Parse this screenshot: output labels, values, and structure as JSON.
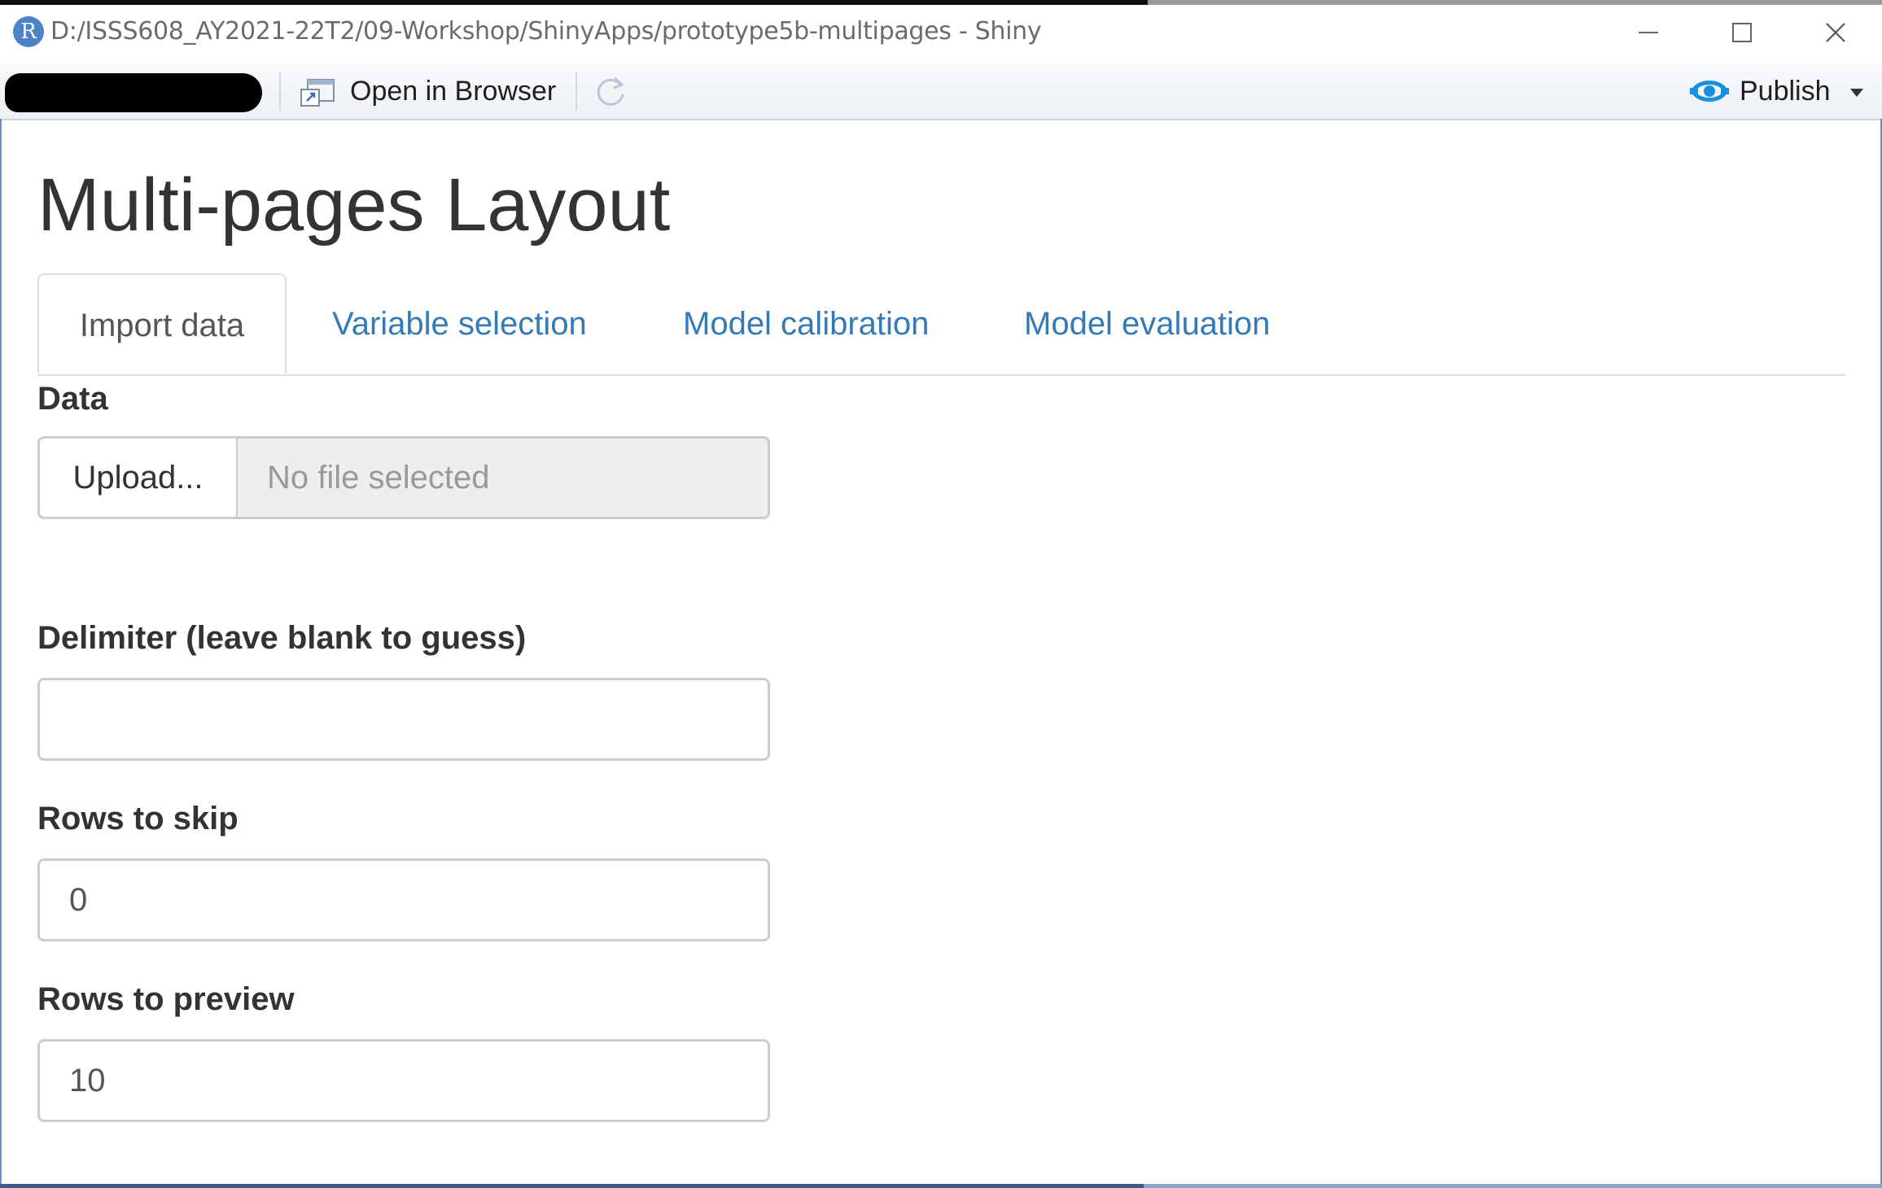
{
  "window": {
    "title": "D:/ISSS608_AY2021-22T2/09-Workshop/ShinyApps/prototype5b-multipages - Shiny",
    "logo_letter": "R",
    "minimize_icon": "minimize-icon",
    "maximize_icon": "maximize-icon",
    "close_icon": "close-icon"
  },
  "toolbar": {
    "open_in_browser_label": "Open in Browser",
    "open_in_browser_icon": "browser-window-icon",
    "reload_icon": "refresh-icon",
    "publish_label": "Publish",
    "publish_icon": "publish-icon",
    "publish_caret_icon": "chevron-down-icon"
  },
  "page": {
    "title": "Multi-pages Layout",
    "tabs": [
      {
        "label": "Import data",
        "active": true
      },
      {
        "label": "Variable selection",
        "active": false
      },
      {
        "label": "Model calibration",
        "active": false
      },
      {
        "label": "Model evaluation",
        "active": false
      }
    ]
  },
  "form": {
    "data_label": "Data",
    "upload_button": "Upload...",
    "file_placeholder": "No file selected",
    "delimiter_label": "Delimiter (leave blank to guess)",
    "delimiter_value": "",
    "rows_skip_label": "Rows to skip",
    "rows_skip_value": "0",
    "rows_preview_label": "Rows to preview",
    "rows_preview_value": "10"
  },
  "colors": {
    "link": "#337ab7",
    "accent_r": "#4b83c6",
    "publish": "#1a8fe0"
  }
}
